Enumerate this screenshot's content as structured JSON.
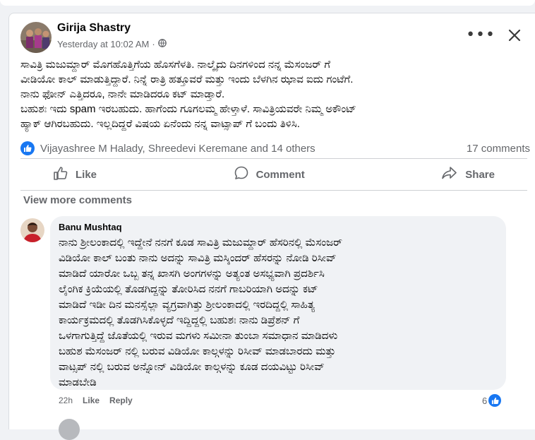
{
  "post": {
    "author": "Girija Shastry",
    "timestamp": "Yesterday at 10:02 AM",
    "separator": "·",
    "privacy_icon": "globe-icon",
    "text": "ಸಾವಿತ್ರಿ ಮಜುಮ್ದಾರ್ ಮೊಗಹೊತ್ತಿಗೆಯ ಹೊಸಗೆಳತಿ. ನಾಲ್ಕೈದು ದಿನಗಳಿಂದ ನನ್ನ ಮೆಸಂಜರ್ ಗೆ\nವೀಡಿಯೋ ಕಾಲ್ ಮಾಡುತ್ತಿದ್ದಾರೆ. ನಿನ್ನೆ ರಾತ್ರಿ ಹತ್ತೂವರೆ ಮತ್ತು ಇಂದು ಬೆಳಗಿನ ಝಾವ ಐದು ಗಂಟೆಗೆ.\nನಾನು ಫೋನ್ ಎತ್ತಿದರೂ, ನಾನೇ ಮಾಡಿದರೂ ಕಟ್ ಮಾಡ್ತಾರೆ.\n ಬಹುಶಃ ಇದು spam ಇರಬಹುದು. ಹಾಗೆಂದು ಗೂಗಲಮ್ಮ ಹೇಳ್ತಾಳೆ. ಸಾವಿತ್ರಿಯವರೇ ನಿಮ್ಮ ಅಕೌಂಟ್\nಹ್ಯಾಕ್ ಆಗಿರಬಹುದು. ಇಲ್ಲದಿದ್ದರೆ ವಿಷಯ ಏನೆಂದು ನನ್ನ ವಾಟ್ಸಾಪ್ ಗೆ ಬಂದು ತಿಳಿಸಿ.",
    "reactors": "Vijayashree M Halady, Shreedevi Keremane and 14 others",
    "comments_count": "17 comments",
    "actions": {
      "like": "Like",
      "comment": "Comment",
      "share": "Share"
    },
    "view_more": "View more comments"
  },
  "comment": {
    "author": "Banu Mushtaq",
    "text": "ನಾನು ಶ್ರೀಲಂಕಾದಲ್ಲಿ ಇದ್ದೇನೆ ನನಗೆ ಕೂಡ ಸಾವಿತ್ರಿ ಮಜುಮ್ದಾರ್ ಹೆಸರಿನಲ್ಲಿ ಮೆಸಂಜರ್\nವಿಡಿಯೋ ಕಾಲ್ ಬಂತು ನಾನು ಅದನ್ನು ಸಾವಿತ್ರಿ ಮಸ್ಕಿಂದರ್ ಹೆಸರನ್ನು ನೋಡಿ ರಿಸೀವ್\nಮಾಡಿದೆ ಯಾರೋ ಒಬ್ಬ ತನ್ನ ಖಾಸಗಿ ಅಂಗಗಳನ್ನು ಅತ್ಯಂತ ಅಸಭ್ಯವಾಗಿ ಪ್ರದರ್ಶಿಸಿ\nಲೈಂಗಿಕ ಕ್ರಿಯೆಯಲ್ಲಿ ತೊಡಗಿದ್ದನ್ನು ತೋರಿಸಿದ ನನಗೆ ಗಾಬರಿಯಾಗಿ ಅದನ್ನು ಕಟ್\nಮಾಡಿದೆ ಇಡೀ ದಿನ ಮನಸ್ಸೆಲ್ಲಾ ವ್ಯಗ್ರವಾಗಿತ್ತು ಶ್ರೀಲಂಕಾದಲ್ಲಿ ಇರದಿದ್ದಲ್ಲಿ ಸಾಹಿತ್ಯ\nಕಾರ್ಯಕ್ರಮದಲ್ಲಿ ತೊಡಗಿಸಿಕೊಳ್ಳದೆ ಇದ್ದಿದ್ದಲ್ಲಿ ಬಹುಶಃ ನಾನು ಡಿಪ್ರೆಶನ್ ಗೆ\nಒಳಗಾಗುತ್ತಿದ್ದೆ ಜೊತೆಯಲ್ಲಿ ಇರುವ ಮಗಳು ಸಮೀನಾ ತುಂಬಾ ಸಮಾಧಾನ ಮಾಡಿದಳು\nಬಹುಶ ಮೆಸಂಜರ್ ನಲ್ಲಿ ಬರುವ ವಿಡಿಯೋ ಕಾಲ್ಗಳನ್ನು ರಿಸೀವ್ ಮಾಡಬಾರದು ಮತ್ತು\nವಾಟ್ಸಪ್ ನಲ್ಲಿ ಬರುವ ಅನ್ನೋನ್ ವಿಡಿಯೋ ಕಾಲ್ಗಳನ್ನು ಕೂಡ ದಯವಿಟ್ಟು ರಿಸೀವ್\nಮಾಡಬೇಡಿ",
    "time": "22h",
    "like_label": "Like",
    "reply_label": "Reply",
    "reaction_count": "6"
  },
  "icons": {
    "more": "more-options-icon",
    "close": "close-icon",
    "like_reaction": "like-reaction-icon",
    "like_action": "thumbs-up-icon",
    "comment_action": "comment-bubble-icon",
    "share_action": "share-arrow-icon"
  },
  "colors": {
    "brand_blue": "#1877f2",
    "muted_text": "#65676b",
    "bubble_bg": "#f0f2f5"
  }
}
